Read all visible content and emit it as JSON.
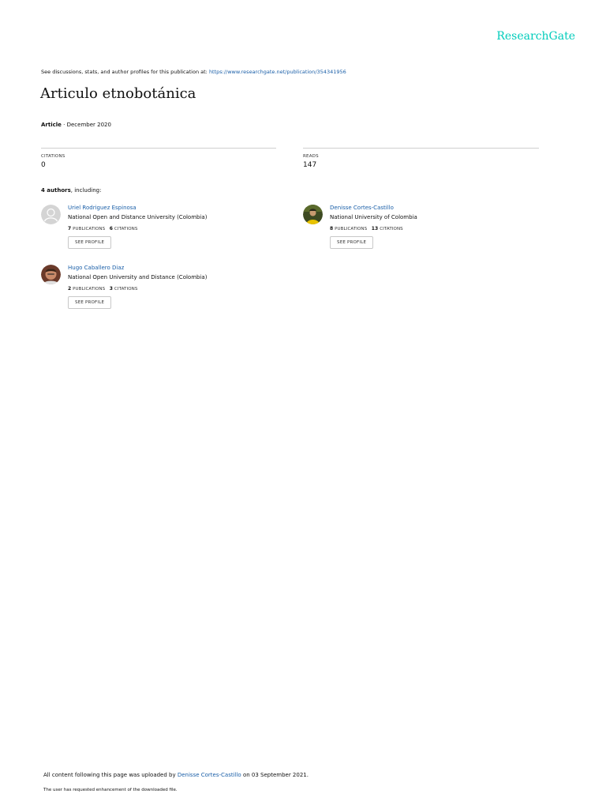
{
  "header": {
    "logo": "ResearchGate",
    "discussion_text": "See discussions, stats, and author profiles for this publication at: ",
    "publication_url": "https://www.researchgate.net/publication/354341956"
  },
  "publication": {
    "title": "Articulo etnobotánica",
    "type": "Article",
    "date": " · December 2020"
  },
  "stats": {
    "citations_label": "CITATIONS",
    "citations": "0",
    "reads_label": "READS",
    "reads": "147"
  },
  "authors_section": {
    "count": "4 authors",
    "suffix": ", including:"
  },
  "authors": [
    {
      "name": "Uriel Rodriguez Espinosa",
      "institution": "National Open and Distance University (Colombia)",
      "publications": "7",
      "publications_label": "PUBLICATIONS",
      "citations": "6",
      "citations_label": "CITATIONS",
      "button": "SEE PROFILE",
      "avatar": "placeholder-avatar"
    },
    {
      "name": "Denisse Cortes-Castillo",
      "institution": "National University of Colombia",
      "publications": "8",
      "publications_label": "PUBLICATIONS",
      "citations": "13",
      "citations_label": "CITATIONS",
      "button": "SEE PROFILE",
      "avatar": "photo-avatar"
    },
    {
      "name": "Hugo Caballero Diaz",
      "institution": "National Open University and Distance (Colombia)",
      "publications": "2",
      "publications_label": "PUBLICATIONS",
      "citations": "3",
      "citations_label": "CITATIONS",
      "button": "SEE PROFILE",
      "avatar": "photo-avatar"
    }
  ],
  "footer": {
    "uploaded_prefix": "All content following this page was uploaded by ",
    "uploader": "Denisse Cortes-Castillo",
    "uploaded_suffix": " on 03 September 2021.",
    "enhancement_note": "The user has requested enhancement of the downloaded file."
  },
  "colors": {
    "brand": "#00ccbb",
    "link": "#1a5fa8",
    "divider": "#cfcfcf"
  }
}
